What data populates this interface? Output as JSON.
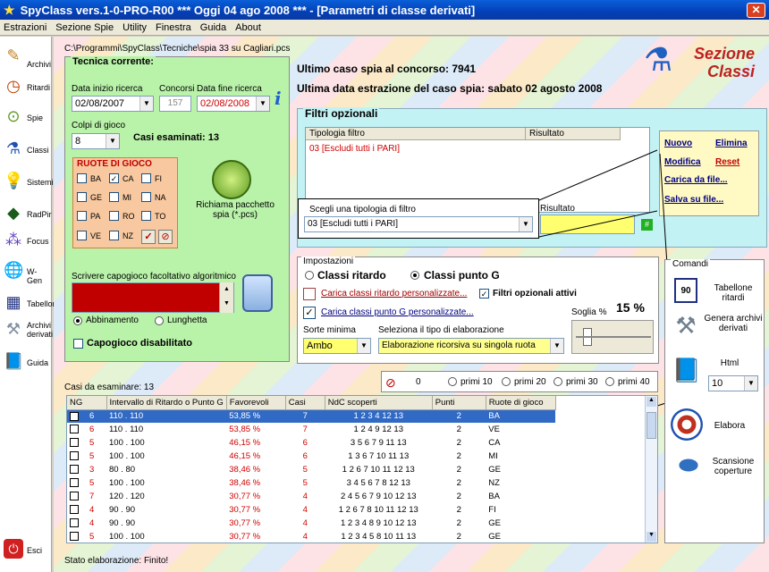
{
  "window": {
    "title": "SpyClass vers.1-0-PRO-R00  ***  Oggi 04 ago 2008  ***   - [Parametri di classe derivati]"
  },
  "menu": [
    "Estrazioni",
    "Sezione Spie",
    "Utility",
    "Finestra",
    "Guida",
    "About"
  ],
  "sidebar": [
    {
      "label": "Archivi",
      "icon": "pencil-icon"
    },
    {
      "label": "Ritardi",
      "icon": "clock-icon"
    },
    {
      "label": "Spie",
      "icon": "spy-lens-icon"
    },
    {
      "label": "Classi",
      "icon": "flask-icon"
    },
    {
      "label": "Sistemi",
      "icon": "lightbulb-icon"
    },
    {
      "label": "RadPir",
      "icon": "pyramid-icon"
    },
    {
      "label": "Focus",
      "icon": "focus-icon"
    },
    {
      "label": "W-Gen",
      "icon": "globe-icon"
    },
    {
      "label": "Tabellone",
      "icon": "calendar-icon"
    },
    {
      "label": "Archivi derivati",
      "icon": "tools-icon"
    },
    {
      "label": "Guida",
      "icon": "book-icon"
    },
    {
      "label": "Esci",
      "icon": "power-icon"
    }
  ],
  "path": "C:\\Programmi\\SpyClass\\Tecniche\\spia 33 su Cagliari.pcs",
  "header": {
    "sezione_line1": "Sezione",
    "sezione_line2": "Classi",
    "ultimo_caso": "Ultimo caso spia al concorso: 7941",
    "ultima_data": "Ultima data estrazione del caso spia: sabato 02 agosto 2008"
  },
  "tecnica": {
    "title": "Tecnica corrente:",
    "data_inizio_label": "Data inizio ricerca",
    "data_inizio": "02/08/2007",
    "concorsi_label": "Concorsi",
    "concorsi": "157",
    "data_fine_label": "Data fine ricerca",
    "data_fine": "02/08/2008",
    "colpi_label": "Colpi di gioco",
    "colpi": "8",
    "casi_esaminati": "Casi esaminati: 13",
    "ruote_title": "RUOTE DI GIOCO",
    "ruote": [
      "BA",
      "CA",
      "FI",
      "GE",
      "MI",
      "NA",
      "PA",
      "RO",
      "TO",
      "VE",
      "NZ"
    ],
    "richiama": "Richiama pacchetto spia (*.pcs)",
    "capogioco_label": "Scrivere capogioco facoltativo algoritmico",
    "abbinamento": "Abbinamento",
    "lunghetta": "Lunghetta",
    "capogioco_disab": "Capogioco disabilitato"
  },
  "filtri": {
    "title": "Filtri opzionali",
    "col_tipologia": "Tipologia filtro",
    "col_risultato": "Risultato",
    "row": "03 [Escludi tutti i PARI]",
    "scegli_label": "Scegli una tipologia di filtro",
    "scegli_value": "03 [Escludi tutti i PARI]",
    "risultato_label": "Risultato",
    "actions": {
      "nuovo": "Nuovo",
      "elimina": "Elimina",
      "modifica": "Modifica",
      "reset": "Reset",
      "carica": "Carica da file...",
      "salva": "Salva su file..."
    }
  },
  "impostazioni": {
    "title": "Impostazioni",
    "classi_ritardo": "Classi ritardo",
    "classi_punto_g": "Classi punto G",
    "carica_ritardo": "Carica classi ritardo personalizzate...",
    "filtri_attivi": "Filtri opzionali attivi",
    "carica_punto_g": "Carica classi punto G personalizzate...",
    "soglia_label": "Soglia %",
    "soglia": "15 %",
    "sorte_label": "Sorte minima",
    "sorte": "Ambo",
    "tipo_label": "Seleziona il tipo di elaborazione",
    "tipo": "Elaborazione ricorsiva su singola ruota"
  },
  "comandi": {
    "title": "Comandi",
    "tabellone": "Tabellone ritardi",
    "genera": "Genera archivi derivati",
    "html": "Html",
    "html_value": "10",
    "elabora": "Elabora",
    "scansione": "Scansione coperture"
  },
  "casibar": {
    "zero": "0",
    "p10": "primi 10",
    "p20": "primi 20",
    "p30": "primi 30",
    "p40": "primi 40"
  },
  "grid": {
    "caption": "Casi da esaminare: 13",
    "headers": [
      "NG",
      "Intervallo di Ritardo o Punto G",
      "Favorevoli",
      "Casi",
      "NdC scoperti",
      "Punti",
      "Ruote di gioco"
    ],
    "rows": [
      [
        "6",
        "110 . 110",
        "53,85 %",
        "7",
        "1 2 3 4 12 13",
        "2",
        "BA"
      ],
      [
        "6",
        "110 . 110",
        "53,85 %",
        "7",
        "1 2 4 9 12 13",
        "2",
        "VE"
      ],
      [
        "5",
        "100 . 100",
        "46,15 %",
        "6",
        "3 5 6 7 9 11 13",
        "2",
        "CA"
      ],
      [
        "5",
        "100 . 100",
        "46,15 %",
        "6",
        "1 3 6 7 10 11 13",
        "2",
        "MI"
      ],
      [
        "3",
        "80 . 80",
        "38,46 %",
        "5",
        "1 2 6 7 10 11 12 13",
        "2",
        "GE"
      ],
      [
        "5",
        "100 . 100",
        "38,46 %",
        "5",
        "3 4 5 6 7 8 12 13",
        "2",
        "NZ"
      ],
      [
        "7",
        "120 . 120",
        "30,77 %",
        "4",
        "2 4 5 6 7 9 10 12 13",
        "2",
        "BA"
      ],
      [
        "4",
        "90 . 90",
        "30,77 %",
        "4",
        "1 2 6 7 8 10 11 12 13",
        "2",
        "FI"
      ],
      [
        "4",
        "90 . 90",
        "30,77 %",
        "4",
        "1 2 3 4 8 9 10 12 13",
        "2",
        "GE"
      ],
      [
        "5",
        "100 . 100",
        "30,77 %",
        "4",
        "1 2 3 4 5 8 10 11 13",
        "2",
        "GE"
      ]
    ]
  },
  "status": "Stato elaborazione: Finito!",
  "colors": {
    "green_panel": "#b9f2a9",
    "cyan_panel": "#c3f2f4",
    "selection": "#316ac5",
    "red": "#d00000"
  }
}
